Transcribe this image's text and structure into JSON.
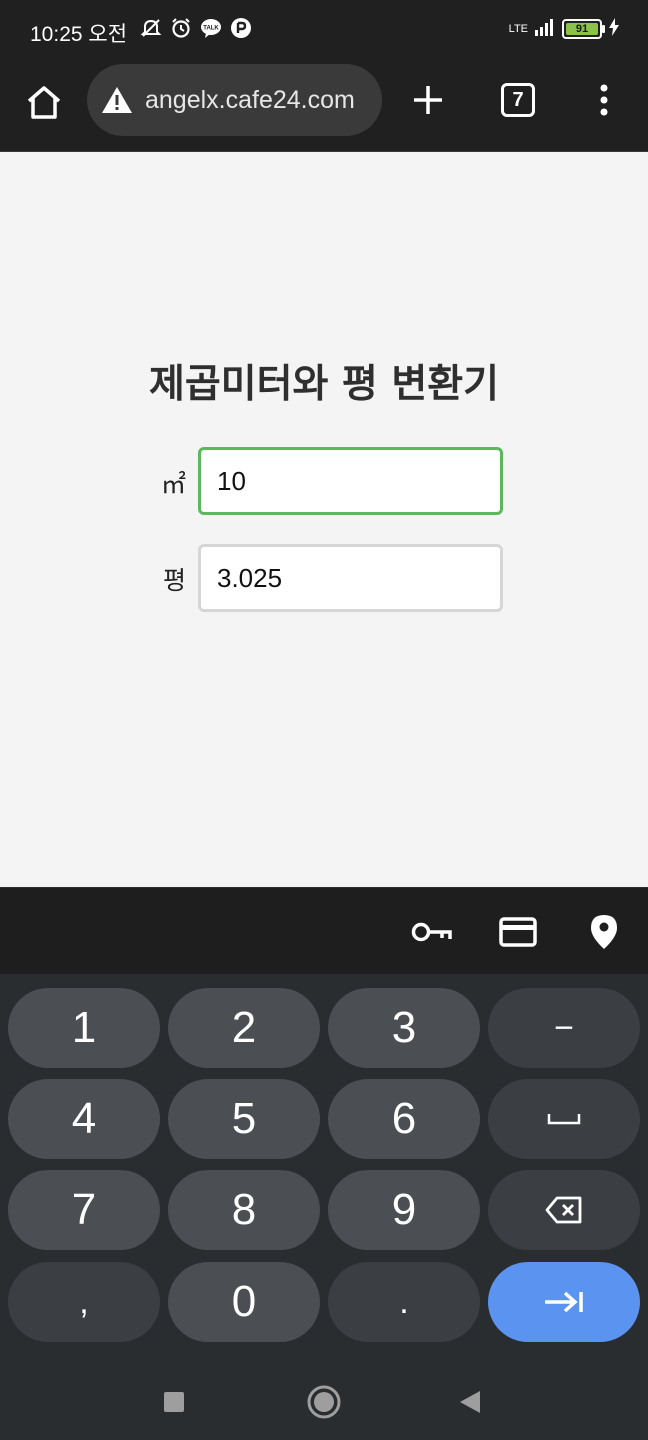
{
  "status_bar": {
    "time": "10:25 오전",
    "network": "LTE",
    "battery": "91"
  },
  "browser": {
    "url": "angelx.cafe24.com",
    "tab_count": "7"
  },
  "page": {
    "title": "제곱미터와 평 변환기",
    "sqm_label": "㎡",
    "sqm_value": "10",
    "pyeong_label": "평",
    "pyeong_value": "3.025"
  },
  "keyboard": {
    "keys": [
      "1",
      "2",
      "3",
      "−",
      "4",
      "5",
      "6",
      "␣",
      "7",
      "8",
      "9",
      "⌫",
      ",",
      "0",
      ".",
      "⇥"
    ]
  },
  "colors": {
    "focus_border": "#5cb85c",
    "enter_key": "#5b93f0",
    "battery": "#8bc34a"
  }
}
